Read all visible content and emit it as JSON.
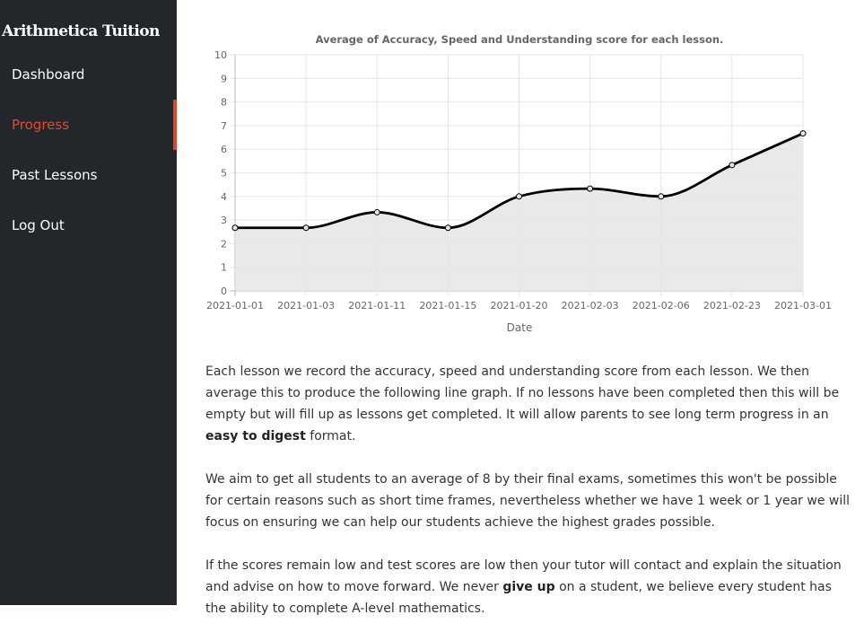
{
  "sidebar": {
    "brand": "Arithmetica Tuition",
    "items": [
      {
        "label": "Dashboard",
        "active": false
      },
      {
        "label": "Progress",
        "active": true
      },
      {
        "label": "Past Lessons",
        "active": false
      },
      {
        "label": "Log Out",
        "active": false
      }
    ]
  },
  "colors": {
    "sidebar_bg": "#23262b",
    "accent": "#e8472b",
    "area_fill": "#e5e5e5",
    "line": "#000000"
  },
  "chart_data": {
    "type": "area",
    "title": "Average of Accuracy, Speed and Understanding score for each lesson.",
    "xlabel": "Date",
    "ylabel": "",
    "categories": [
      "2021-01-01",
      "2021-01-03",
      "2021-01-11",
      "2021-01-15",
      "2021-01-20",
      "2021-02-03",
      "2021-02-06",
      "2021-02-23",
      "2021-03-01"
    ],
    "values": [
      2.67,
      2.67,
      3.33,
      2.67,
      4.0,
      4.33,
      4.0,
      5.33,
      6.67
    ],
    "ylim": [
      0,
      10
    ],
    "yticks": [
      "0",
      "1",
      "2",
      "3",
      "4",
      "5",
      "6",
      "7",
      "8",
      "9",
      "10"
    ],
    "grid": true,
    "legend": "none"
  },
  "content": {
    "p1_a": "Each lesson we record the accuracy, speed and understanding score from each lesson. We then average this to produce the following line graph. If no lessons have been completed then this will be empty but will fill up as lessons get completed. It will allow parents to see long term progress in an ",
    "p1_bold": "easy to digest",
    "p1_b": " format.",
    "p2": "We aim to get all students to an average of 8 by their final exams, sometimes this won't be possible for certain reasons such as short time frames, nevertheless whether we have 1 week or 1 year we will focus on ensuring we can help our students achieve the highest grades possible.",
    "p3_a": "If the scores remain low and test scores are low then your tutor will contact and explain the situation and advise on how to move forward. We never ",
    "p3_bold": "give up",
    "p3_b": " on a student, we believe every student has the ability to complete A-level mathematics."
  }
}
